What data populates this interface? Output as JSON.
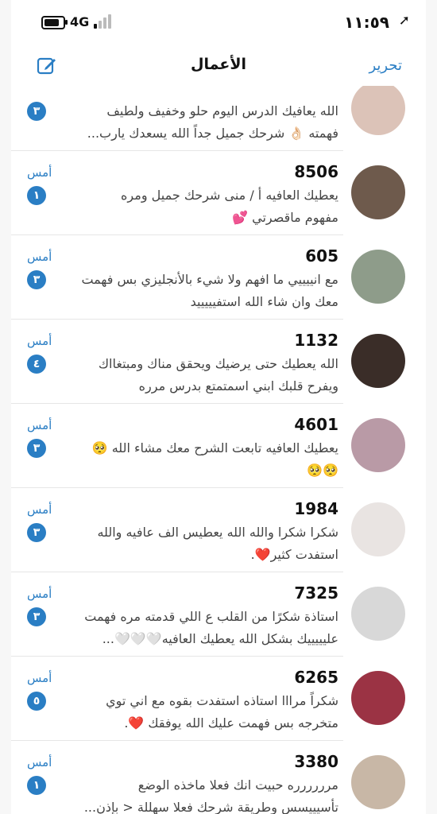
{
  "status": {
    "time": "١١:٥٩",
    "network": "4G"
  },
  "nav": {
    "title": "الأعمال",
    "edit": "تحرير"
  },
  "chats": [
    {
      "name": "",
      "date": "",
      "badge": "٣",
      "line1": "الله يعافيك الدرس اليوم حلو وخفيف ولطيف",
      "line2": "فهمته 👌🏻 شرحك جميل جداً الله يسعدك يارب...",
      "avatar": "#dcc3b8"
    },
    {
      "name": "8506",
      "date": "أمس",
      "badge": "١",
      "line1": "يعطيك العافيه أ / منى  شرحك جميل ومره",
      "line2": "مفهوم ماقصرتي 💕",
      "avatar": "#6e5a4c"
    },
    {
      "name": "605",
      "date": "أمس",
      "badge": "٣",
      "line1": "مع انييييي ما افهم ولا شيء بالأنجليزي بس فهمت",
      "line2": "معك وان شاء الله استفيييييد",
      "avatar": "#8e9c8a"
    },
    {
      "name": "1132",
      "date": "أمس",
      "badge": "٤",
      "line1": "الله يعطيك حتى يرضيك ويحقق مناك ومبتغااك",
      "line2": "ويفرح قلبك ابني اسمتمتع بدرس مرره",
      "avatar": "#3a2d28"
    },
    {
      "name": "4601",
      "date": "أمس",
      "badge": "٣",
      "line1": "يعطيك العافيه تابعت الشرح معك مشاء الله 🥺",
      "line2": "🥺🥺",
      "avatar": "#b99aa6"
    },
    {
      "name": "1984",
      "date": "أمس",
      "badge": "٣",
      "line1": "شكرا شكرا والله  الله يعطيس الف عافيه والله",
      "line2": "استفدت كثير❤️.",
      "avatar": "#e9e4e2"
    },
    {
      "name": "7325",
      "date": "أمس",
      "badge": "٣",
      "line1": "استاذة شكرًا من القلب ع اللي قدمته مره فهمت",
      "line2": "عليييييك بشكل الله يعطيك العافيه🤍🤍🤍...",
      "avatar": "#d8d8d8"
    },
    {
      "name": "6265",
      "date": "أمس",
      "badge": "٥",
      "line1": "شكراً مرااا استاذه استفدت بقوه مع اني توي",
      "line2": "متخرجه بس فهمت عليك الله يوفقك ❤️.",
      "avatar": "#9b3344"
    },
    {
      "name": "3380",
      "date": "أمس",
      "badge": "١",
      "line1": "مرررررره حبيت انك فعلا ماخذه الوضع",
      "line2": "تأسيييسس وطريقة شرحك فعلا سهللة < بإذن...",
      "avatar": "#c8b7a6"
    }
  ]
}
